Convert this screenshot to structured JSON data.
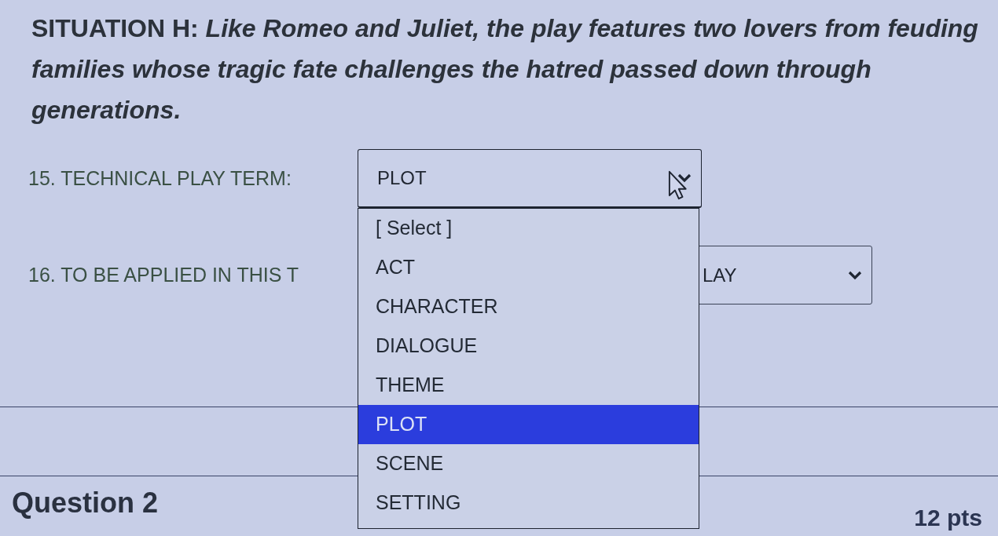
{
  "situation": {
    "text": "SITUATION H: *Like Romeo and Juliet, the play features two lovers from feuding families whose tragic fate challenges the hatred passed down through generations.*"
  },
  "items": [
    {
      "label": "15. TECHNICAL PLAY TERM:",
      "value": "PLOT",
      "expanded": true,
      "options": [
        {
          "label": "[ Select ]",
          "selected": false
        },
        {
          "label": "ACT",
          "selected": false
        },
        {
          "label": "CHARACTER",
          "selected": false
        },
        {
          "label": "DIALOGUE",
          "selected": false
        },
        {
          "label": "THEME",
          "selected": false
        },
        {
          "label": "PLOT",
          "selected": true
        },
        {
          "label": "SCENE",
          "selected": false
        },
        {
          "label": "SETTING",
          "selected": false
        }
      ]
    },
    {
      "label": "16. TO BE APPLIED IN THIS T",
      "value": "LAY",
      "expanded": false
    }
  ],
  "question": {
    "title": "Question 2",
    "points": "12 pts"
  }
}
